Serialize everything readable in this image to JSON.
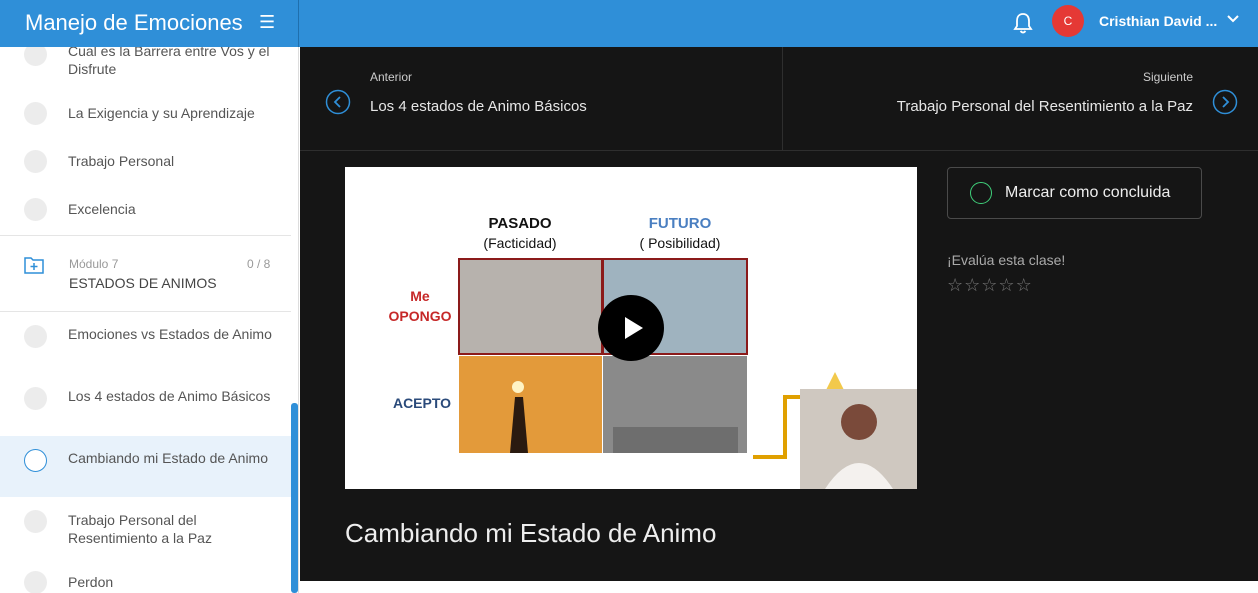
{
  "header": {
    "title": "Manejo de Emociones",
    "menu_icon": "menu-icon",
    "avatar_initial": "C",
    "user_name": "Cristhian David ...",
    "accent": "#2f8fd8"
  },
  "sidebar": {
    "lessons_before": [
      {
        "label": "Cual es la Barrera entre Vos y el Disfrute"
      },
      {
        "label": "La Exigencia y su Aprendizaje"
      },
      {
        "label": "Trabajo Personal"
      },
      {
        "label": "Excelencia"
      }
    ],
    "module": {
      "number": "Módulo 7",
      "count": "0 / 8",
      "name": "ESTADOS DE ANIMOS"
    },
    "lessons_after": [
      {
        "label": "Emociones vs Estados de Animo"
      },
      {
        "label": "Los 4 estados de Animo Básicos"
      },
      {
        "label": "Cambiando mi Estado de Animo",
        "active": true
      },
      {
        "label": "Trabajo Personal del Resentimiento a la Paz"
      },
      {
        "label": "Perdon"
      }
    ]
  },
  "nav": {
    "prev_caption": "Anterior",
    "prev_title": "Los 4 estados de Animo Básicos",
    "next_caption": "Siguiente",
    "next_title": "Trabajo Personal del Resentimiento a la Paz"
  },
  "video": {
    "slide": {
      "col1_title": "PASADO",
      "col1_sub": "(Facticidad)",
      "col2_title": "FUTURO",
      "col2_sub": "( Posibilidad)",
      "row1_label_a": "Me",
      "row1_label_b": "OPONGO",
      "row2_label": "ACEPTO"
    }
  },
  "actions": {
    "complete_label": "Marcar como concluida",
    "rate_text": "¡Evalúa esta clase!",
    "stars": 5
  },
  "lesson_title": "Cambiando mi Estado de Animo"
}
